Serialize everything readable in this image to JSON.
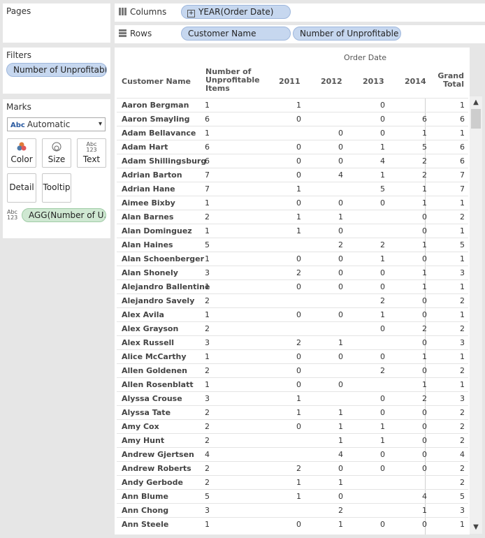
{
  "pages": {
    "title": "Pages"
  },
  "filters": {
    "title": "Filters",
    "pill": "Number of Unprofitabl.."
  },
  "marks": {
    "title": "Marks",
    "type": "Automatic",
    "type_icon": "Abc",
    "buttons": {
      "color": "Color",
      "size": "Size",
      "text": "Text",
      "detail": "Detail",
      "tooltip": "Tooltip"
    },
    "text_pill": "AGG(Number of U..",
    "text_pill_icon": "Abc 123"
  },
  "shelves": {
    "columns_label": "Columns",
    "columns_pill": "YEAR(Order Date)",
    "rows_label": "Rows",
    "rows_pill_1": "Customer Name",
    "rows_pill_2": "Number of Unprofitable I.."
  },
  "table": {
    "group_header": "Order Date",
    "col_customer": "Customer Name",
    "col_number": "Number of\nUnprofitable\nItems",
    "years": [
      "2011",
      "2012",
      "2013",
      "2014"
    ],
    "grand_total": "Grand\nTotal",
    "rows": [
      {
        "name": "Aaron Bergman",
        "n": "1",
        "y": [
          "1",
          "",
          "0",
          ""
        ],
        "g": "1"
      },
      {
        "name": "Aaron Smayling",
        "n": "6",
        "y": [
          "0",
          "",
          "0",
          "6"
        ],
        "g": "6"
      },
      {
        "name": "Adam Bellavance",
        "n": "1",
        "y": [
          "",
          "0",
          "0",
          "1"
        ],
        "g": "1"
      },
      {
        "name": "Adam Hart",
        "n": "6",
        "y": [
          "0",
          "0",
          "1",
          "5"
        ],
        "g": "6"
      },
      {
        "name": "Adam Shillingsburg",
        "n": "6",
        "y": [
          "0",
          "0",
          "4",
          "2"
        ],
        "g": "6"
      },
      {
        "name": "Adrian Barton",
        "n": "7",
        "y": [
          "0",
          "4",
          "1",
          "2"
        ],
        "g": "7"
      },
      {
        "name": "Adrian Hane",
        "n": "7",
        "y": [
          "1",
          "",
          "5",
          "1"
        ],
        "g": "7"
      },
      {
        "name": "Aimee Bixby",
        "n": "1",
        "y": [
          "0",
          "0",
          "0",
          "1"
        ],
        "g": "1"
      },
      {
        "name": "Alan Barnes",
        "n": "2",
        "y": [
          "1",
          "1",
          "",
          "0"
        ],
        "g": "2"
      },
      {
        "name": "Alan Dominguez",
        "n": "1",
        "y": [
          "1",
          "0",
          "",
          "0"
        ],
        "g": "1"
      },
      {
        "name": "Alan Haines",
        "n": "5",
        "y": [
          "",
          "2",
          "2",
          "1"
        ],
        "g": "5"
      },
      {
        "name": "Alan Schoenberger",
        "n": "1",
        "y": [
          "0",
          "0",
          "1",
          "0"
        ],
        "g": "1"
      },
      {
        "name": "Alan Shonely",
        "n": "3",
        "y": [
          "2",
          "0",
          "0",
          "1"
        ],
        "g": "3"
      },
      {
        "name": "Alejandro Ballentine",
        "n": "1",
        "y": [
          "0",
          "0",
          "0",
          "1"
        ],
        "g": "1"
      },
      {
        "name": "Alejandro Savely",
        "n": "2",
        "y": [
          "",
          "",
          "2",
          "0"
        ],
        "g": "2"
      },
      {
        "name": "Alex Avila",
        "n": "1",
        "y": [
          "0",
          "0",
          "1",
          "0"
        ],
        "g": "1"
      },
      {
        "name": "Alex Grayson",
        "n": "2",
        "y": [
          "",
          "",
          "0",
          "2"
        ],
        "g": "2"
      },
      {
        "name": "Alex Russell",
        "n": "3",
        "y": [
          "2",
          "1",
          "",
          "0"
        ],
        "g": "3"
      },
      {
        "name": "Alice McCarthy",
        "n": "1",
        "y": [
          "0",
          "0",
          "0",
          "1"
        ],
        "g": "1"
      },
      {
        "name": "Allen Goldenen",
        "n": "2",
        "y": [
          "0",
          "",
          "2",
          "0"
        ],
        "g": "2"
      },
      {
        "name": "Allen Rosenblatt",
        "n": "1",
        "y": [
          "0",
          "0",
          "",
          "1"
        ],
        "g": "1"
      },
      {
        "name": "Alyssa Crouse",
        "n": "3",
        "y": [
          "1",
          "",
          "0",
          "2"
        ],
        "g": "3"
      },
      {
        "name": "Alyssa Tate",
        "n": "2",
        "y": [
          "1",
          "1",
          "0",
          "0"
        ],
        "g": "2"
      },
      {
        "name": "Amy Cox",
        "n": "2",
        "y": [
          "0",
          "1",
          "1",
          "0"
        ],
        "g": "2"
      },
      {
        "name": "Amy Hunt",
        "n": "2",
        "y": [
          "",
          "1",
          "1",
          "0"
        ],
        "g": "2"
      },
      {
        "name": "Andrew Gjertsen",
        "n": "4",
        "y": [
          "",
          "4",
          "0",
          "0"
        ],
        "g": "4"
      },
      {
        "name": "Andrew Roberts",
        "n": "2",
        "y": [
          "2",
          "0",
          "0",
          "0"
        ],
        "g": "2"
      },
      {
        "name": "Andy Gerbode",
        "n": "2",
        "y": [
          "1",
          "1",
          "",
          ""
        ],
        "g": "2"
      },
      {
        "name": "Ann Blume",
        "n": "5",
        "y": [
          "1",
          "0",
          "",
          "4"
        ],
        "g": "5"
      },
      {
        "name": "Ann Chong",
        "n": "3",
        "y": [
          "",
          "2",
          "",
          "1"
        ],
        "g": "3"
      },
      {
        "name": "Ann Steele",
        "n": "1",
        "y": [
          "0",
          "1",
          "0",
          "0"
        ],
        "g": "1"
      }
    ]
  }
}
